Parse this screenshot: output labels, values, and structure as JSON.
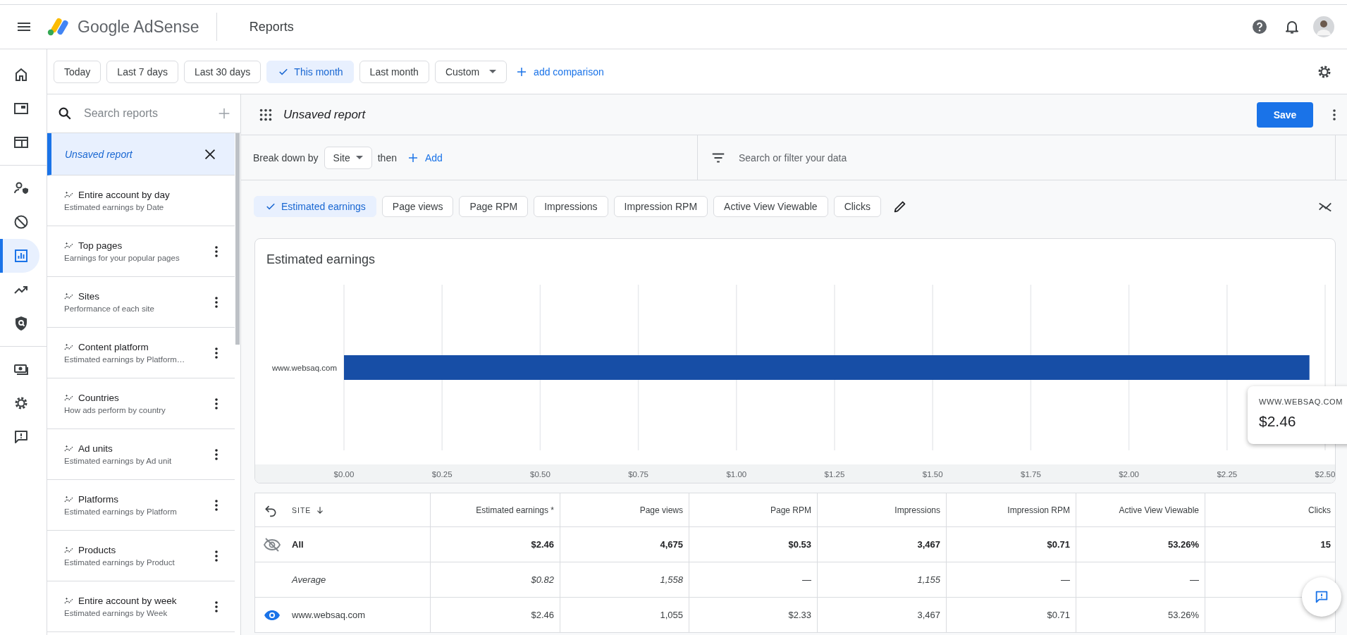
{
  "header": {
    "product": "Google AdSense",
    "page_title": "Reports"
  },
  "date_ranges": [
    {
      "label": "Today",
      "selected": false,
      "kind": "chip"
    },
    {
      "label": "Last 7 days",
      "selected": false,
      "kind": "chip"
    },
    {
      "label": "Last 30 days",
      "selected": false,
      "kind": "chip"
    },
    {
      "label": "This month",
      "selected": true,
      "kind": "chip"
    },
    {
      "label": "Last month",
      "selected": false,
      "kind": "chip"
    },
    {
      "label": "Custom",
      "selected": false,
      "kind": "dropdown"
    }
  ],
  "add_comparison": "add comparison",
  "nav_rail": [
    {
      "selected": false
    },
    {
      "selected": false
    },
    {
      "selected": false
    },
    {
      "selected": false
    },
    {
      "selected": false
    },
    {
      "selected": true
    },
    {
      "selected": false
    },
    {
      "selected": false
    },
    {
      "selected": false
    },
    {
      "selected": false
    },
    {
      "selected": false
    }
  ],
  "report_search": {
    "placeholder": "Search reports"
  },
  "reports": [
    {
      "title": "Unsaved report",
      "selected": true
    },
    {
      "title": "Entire account by day",
      "subtitle": "Estimated earnings by Date",
      "selected": false,
      "menu": false
    },
    {
      "title": "Top pages",
      "subtitle": "Earnings for your popular pages",
      "selected": false,
      "menu": true
    },
    {
      "title": "Sites",
      "subtitle": "Performance of each site",
      "selected": false,
      "menu": true
    },
    {
      "title": "Content platform",
      "subtitle": "Estimated earnings by Platform…",
      "selected": false,
      "menu": true
    },
    {
      "title": "Countries",
      "subtitle": "How ads perform by country",
      "selected": false,
      "menu": true
    },
    {
      "title": "Ad units",
      "subtitle": "Estimated earnings by Ad unit",
      "selected": false,
      "menu": true
    },
    {
      "title": "Platforms",
      "subtitle": "Estimated earnings by Platform",
      "selected": false,
      "menu": true
    },
    {
      "title": "Products",
      "subtitle": "Estimated earnings by Product",
      "selected": false,
      "menu": true
    },
    {
      "title": "Entire account by week",
      "subtitle": "Estimated earnings by Week",
      "selected": false,
      "menu": true
    }
  ],
  "report": {
    "title": "Unsaved report",
    "save": "Save",
    "breakdown_label": "Break down by",
    "dimension": "Site",
    "then": "then",
    "add": "Add",
    "filter": {
      "placeholder": "Search or filter your data"
    }
  },
  "metrics": [
    {
      "label": "Estimated earnings",
      "selected": true
    },
    {
      "label": "Page views",
      "selected": false
    },
    {
      "label": "Page RPM",
      "selected": false
    },
    {
      "label": "Impressions",
      "selected": false
    },
    {
      "label": "Impression RPM",
      "selected": false
    },
    {
      "label": "Active View Viewable",
      "selected": false
    },
    {
      "label": "Clicks",
      "selected": false
    }
  ],
  "chart": {
    "chart_data": {
      "type": "bar",
      "orientation": "horizontal",
      "grid": true,
      "categories": [
        "www.websaq.com"
      ],
      "series": [
        {
          "name": "Estimated earnings",
          "color": "#174ea6",
          "values": [
            2.46
          ]
        }
      ],
      "xlim": [
        0,
        2.5
      ],
      "xticks": [
        {
          "value": 0,
          "label": "$0.00"
        },
        {
          "value": 0.25,
          "label": "$0.25"
        },
        {
          "value": 0.5,
          "label": "$0.50"
        },
        {
          "value": 0.75,
          "label": "$0.75"
        },
        {
          "value": 1,
          "label": "$1.00"
        },
        {
          "value": 1.25,
          "label": "$1.25"
        },
        {
          "value": 1.5,
          "label": "$1.50"
        },
        {
          "value": 1.75,
          "label": "$1.75"
        },
        {
          "value": 2,
          "label": "$2.00"
        },
        {
          "value": 2.25,
          "label": "$2.25"
        },
        {
          "value": 2.5,
          "label": "$2.50"
        }
      ]
    },
    "tooltip": {
      "label": "WWW.WEBSAQ.COM",
      "value": "$2.46"
    }
  },
  "table": {
    "columns": [
      {
        "label": "SITE",
        "sorted": true
      },
      {
        "label": "Estimated earnings *",
        "sorted": false
      },
      {
        "label": "Page views",
        "sorted": false
      },
      {
        "label": "Page RPM",
        "sorted": false
      },
      {
        "label": "Impressions",
        "sorted": false
      },
      {
        "label": "Impression RPM",
        "sorted": false
      },
      {
        "label": "Active View Viewable",
        "sorted": false
      },
      {
        "label": "Clicks",
        "sorted": false
      }
    ],
    "rows": [
      {
        "kind": "total",
        "visible": false,
        "cells": [
          "All",
          "$2.46",
          "4,675",
          "$0.53",
          "3,467",
          "$0.71",
          "53.26%",
          "15"
        ]
      },
      {
        "kind": "average",
        "cells": [
          "Average",
          "$0.82",
          "1,558",
          "—",
          "1,155",
          "—",
          "—"
        ]
      },
      {
        "kind": "site",
        "visible": true,
        "cells": [
          "www.websaq.com",
          "$2.46",
          "1,055",
          "$2.33",
          "3,467",
          "$0.71",
          "53.26%"
        ]
      }
    ]
  }
}
